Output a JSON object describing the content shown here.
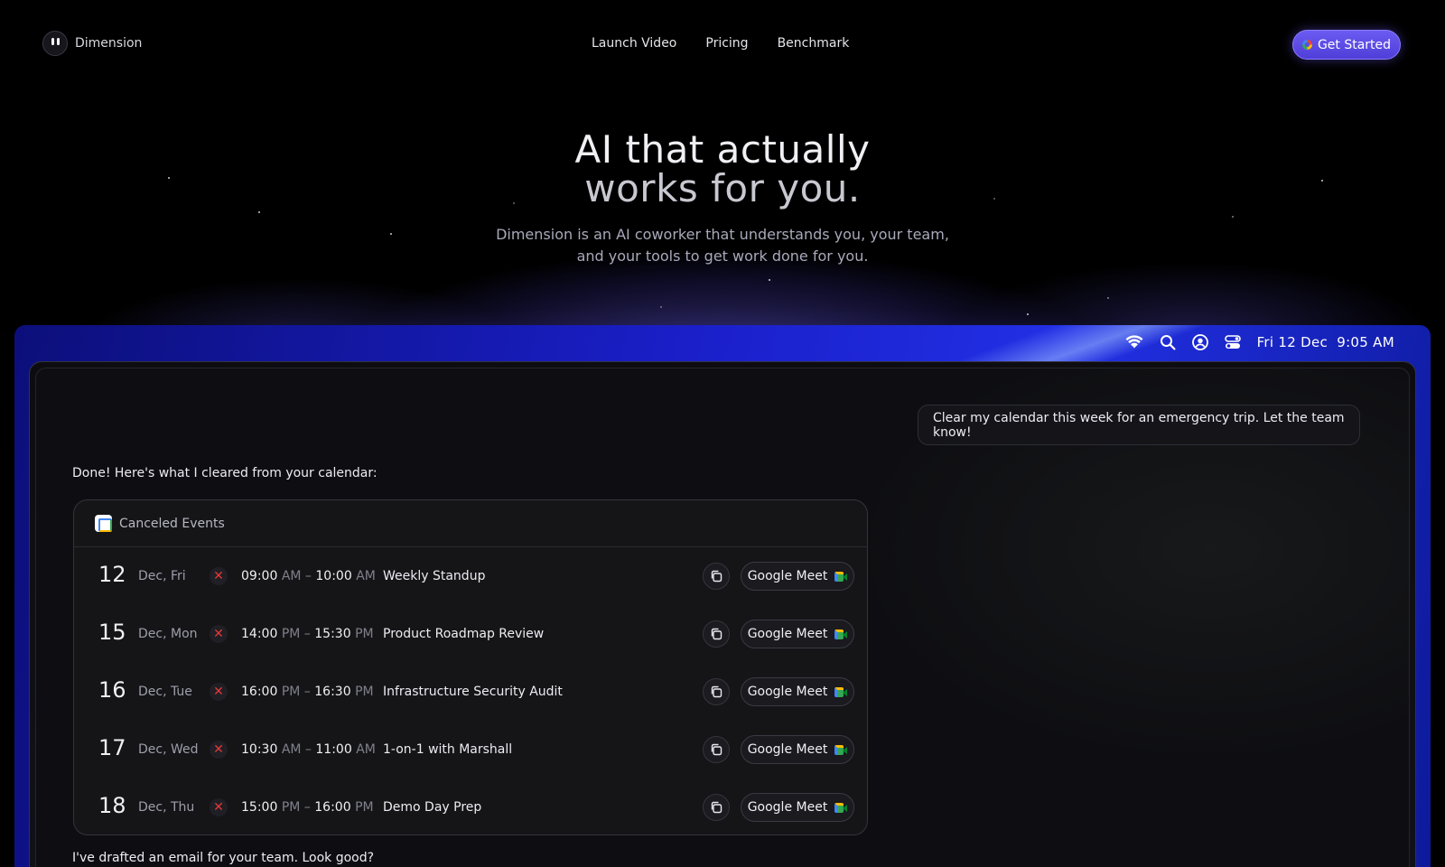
{
  "nav": {
    "brand": "Dimension",
    "links": [
      "Launch Video",
      "Pricing",
      "Benchmark"
    ],
    "cta_label": "Get Started"
  },
  "hero": {
    "title_line1": "AI that actually",
    "title_line2": "works for you.",
    "subtitle": "Dimension is an AI coworker that understands you, your team, and your tools to get work done for you."
  },
  "menubar": {
    "date": "Fri 12 Dec",
    "time": "9:05 AM",
    "icons": [
      "wifi-icon",
      "search-icon",
      "user-icon",
      "control-center-icon"
    ]
  },
  "chat": {
    "user_message": "Clear my calendar this week for an emergency trip. Let the team know!",
    "ai_intro": "Done! Here's what I cleared from your calendar:",
    "ai_followup": "I've drafted an email for your team. Look good?",
    "card_title": "Canceled Events",
    "meet_label": "Google Meet",
    "events": [
      {
        "day": "12",
        "weekday": "Dec, Fri",
        "start": "09:00",
        "start_ampm": "AM",
        "end": "10:00",
        "end_ampm": "AM",
        "title": "Weekly Standup"
      },
      {
        "day": "15",
        "weekday": "Dec, Mon",
        "start": "14:00",
        "start_ampm": "PM",
        "end": "15:30",
        "end_ampm": "PM",
        "title": "Product Roadmap Review"
      },
      {
        "day": "16",
        "weekday": "Dec, Tue",
        "start": "16:00",
        "start_ampm": "PM",
        "end": "16:30",
        "end_ampm": "PM",
        "title": "Infrastructure Security Audit"
      },
      {
        "day": "17",
        "weekday": "Dec, Wed",
        "start": "10:30",
        "start_ampm": "AM",
        "end": "11:00",
        "end_ampm": "AM",
        "title": "1-on-1 with Marshall"
      },
      {
        "day": "18",
        "weekday": "Dec, Thu",
        "start": "15:00",
        "start_ampm": "PM",
        "end": "16:00",
        "end_ampm": "PM",
        "title": "Demo Day Prep"
      }
    ]
  },
  "colors": {
    "accent": "#5b4ae6",
    "device_blue": "#1a1fc9",
    "cancel_red": "#e53935"
  }
}
